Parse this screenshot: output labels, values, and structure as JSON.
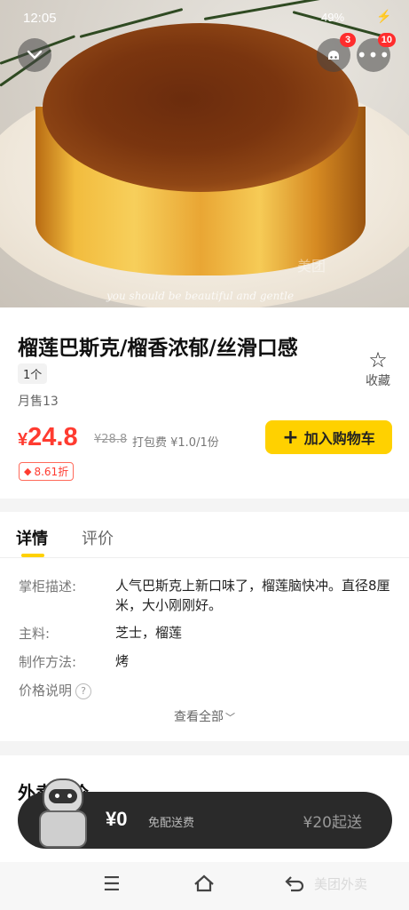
{
  "status_bar": {
    "time": "12:05",
    "battery": "49%"
  },
  "header": {
    "back_icon": "chevron-down-icon",
    "service_badge": "3",
    "more_badge": "10"
  },
  "hero": {
    "watermark": "you should be beautiful and gentle",
    "watermark_brand": "美团"
  },
  "product": {
    "title": "榴莲巴斯克/榴香浓郁/丝滑口感",
    "spec": "1个",
    "monthly_sales": "月售13",
    "favorite_label": "收藏",
    "currency": "¥",
    "price": "24.8",
    "original_price": "¥28.8",
    "packing_fee": "打包费 ¥1.0/1份",
    "add_to_cart": "加入购物车",
    "discount": "8.61折"
  },
  "tabs": {
    "details": "详情",
    "reviews": "评价"
  },
  "details": {
    "description_label": "掌柜描述:",
    "description_value": "人气巴斯克上新口味了，榴莲脑快冲。直径8厘米，大小刚刚好。",
    "ingredients_label": "主料:",
    "ingredients_value": "芝士，榴莲",
    "method_label": "制作方法:",
    "method_value": "烤",
    "price_note_label": "价格说明",
    "see_all": "查看全部"
  },
  "reviews_section": {
    "heading": "外卖评价"
  },
  "cart": {
    "total": "¥0",
    "delivery_fee": "免配送费",
    "minimum": "¥20起送"
  },
  "brand": "美团外卖",
  "colors": {
    "accent": "#ffd100",
    "price": "#ff3b30"
  }
}
